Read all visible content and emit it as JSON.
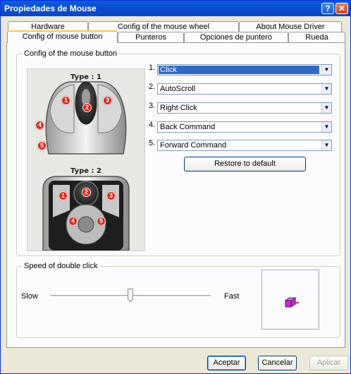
{
  "window": {
    "title": "Propiedades de Mouse",
    "help_label": "?",
    "close_label": "✕"
  },
  "tabs_row1": [
    {
      "label": "Hardware"
    },
    {
      "label": "Config of the mouse wheel"
    },
    {
      "label": "About Mouse Driver"
    }
  ],
  "tabs_row2": [
    {
      "label": "Config of mouse button"
    },
    {
      "label": "Punteros"
    },
    {
      "label": "Opciones de puntero"
    },
    {
      "label": "Rueda"
    }
  ],
  "button_group": {
    "legend": "Config of the mouse button",
    "type1_label": "Type : 1",
    "type2_label": "Type : 2",
    "assignments": [
      {
        "num": "1.",
        "value": "Click"
      },
      {
        "num": "2.",
        "value": "AutoScroll"
      },
      {
        "num": "3.",
        "value": "Right Click"
      },
      {
        "num": "4.",
        "value": "Back Command"
      },
      {
        "num": "5.",
        "value": "Forward Command"
      }
    ],
    "restore_label": "Restore to default",
    "badges": [
      "1",
      "2",
      "3",
      "4",
      "5"
    ]
  },
  "speed_group": {
    "legend": "Speed of double click",
    "slow_label": "Slow",
    "fast_label": "Fast",
    "speed_fraction": 0.5
  },
  "footer": {
    "accept_label": "Aceptar",
    "cancel_label": "Cancelar",
    "apply_label": "Aplicar"
  },
  "colors": {
    "titlebar": "#0a4fd0",
    "selection": "#316ac5",
    "badge": "#d42a1e",
    "tab_accent": "#ffc83c"
  }
}
